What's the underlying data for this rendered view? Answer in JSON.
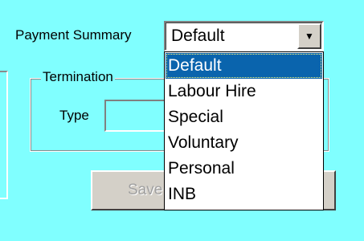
{
  "form": {
    "payment_summary_label": "Payment Summary",
    "payment_summary_value": "Default",
    "termination_group_label": "Termination",
    "type_label": "Type",
    "type_value": "",
    "save_button_label": "Save"
  },
  "dropdown": {
    "options": [
      "Default",
      "Labour Hire",
      "Special",
      "Voluntary",
      "Personal",
      "INB"
    ],
    "selected": "Default"
  },
  "colors": {
    "background": "#80ffff",
    "selection": "#0a64ad"
  },
  "icons": {
    "combo_arrow": "chevron-down-icon"
  }
}
